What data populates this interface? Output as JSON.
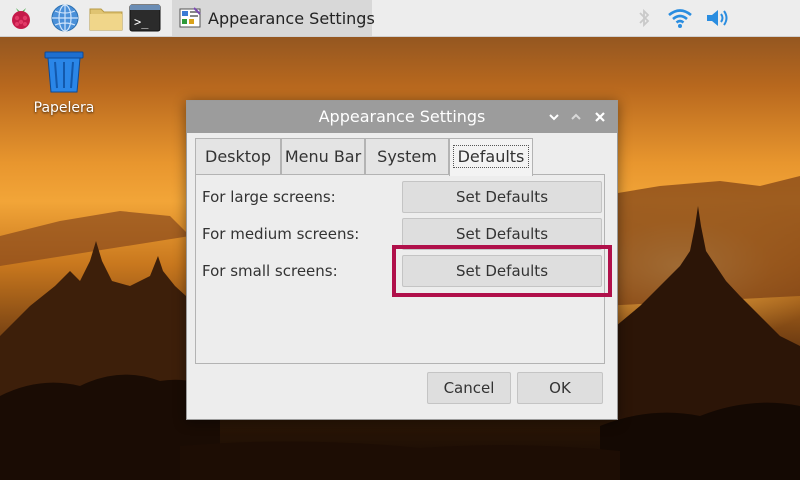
{
  "taskbar": {
    "task_title": "Appearance Settings",
    "icons": [
      "raspberry-menu-icon",
      "web-browser-icon",
      "file-manager-icon",
      "terminal-icon"
    ],
    "tray_icons": [
      "bluetooth-icon",
      "wifi-icon",
      "volume-icon"
    ]
  },
  "desktop": {
    "trash_label": "Papelera"
  },
  "dialog": {
    "title": "Appearance Settings",
    "tabs": [
      {
        "label": "Desktop"
      },
      {
        "label": "Menu Bar"
      },
      {
        "label": "System"
      },
      {
        "label": "Defaults",
        "active": true
      }
    ],
    "rows": [
      {
        "label": "For large screens:",
        "button": "Set Defaults"
      },
      {
        "label": "For medium screens:",
        "button": "Set Defaults"
      },
      {
        "label": "For small screens:",
        "button": "Set Defaults",
        "highlighted": true
      }
    ],
    "cancel_label": "Cancel",
    "ok_label": "OK"
  },
  "colors": {
    "highlight": "#b0104a",
    "titlebar": "#9c9c9c",
    "taskbar": "#ededed"
  }
}
